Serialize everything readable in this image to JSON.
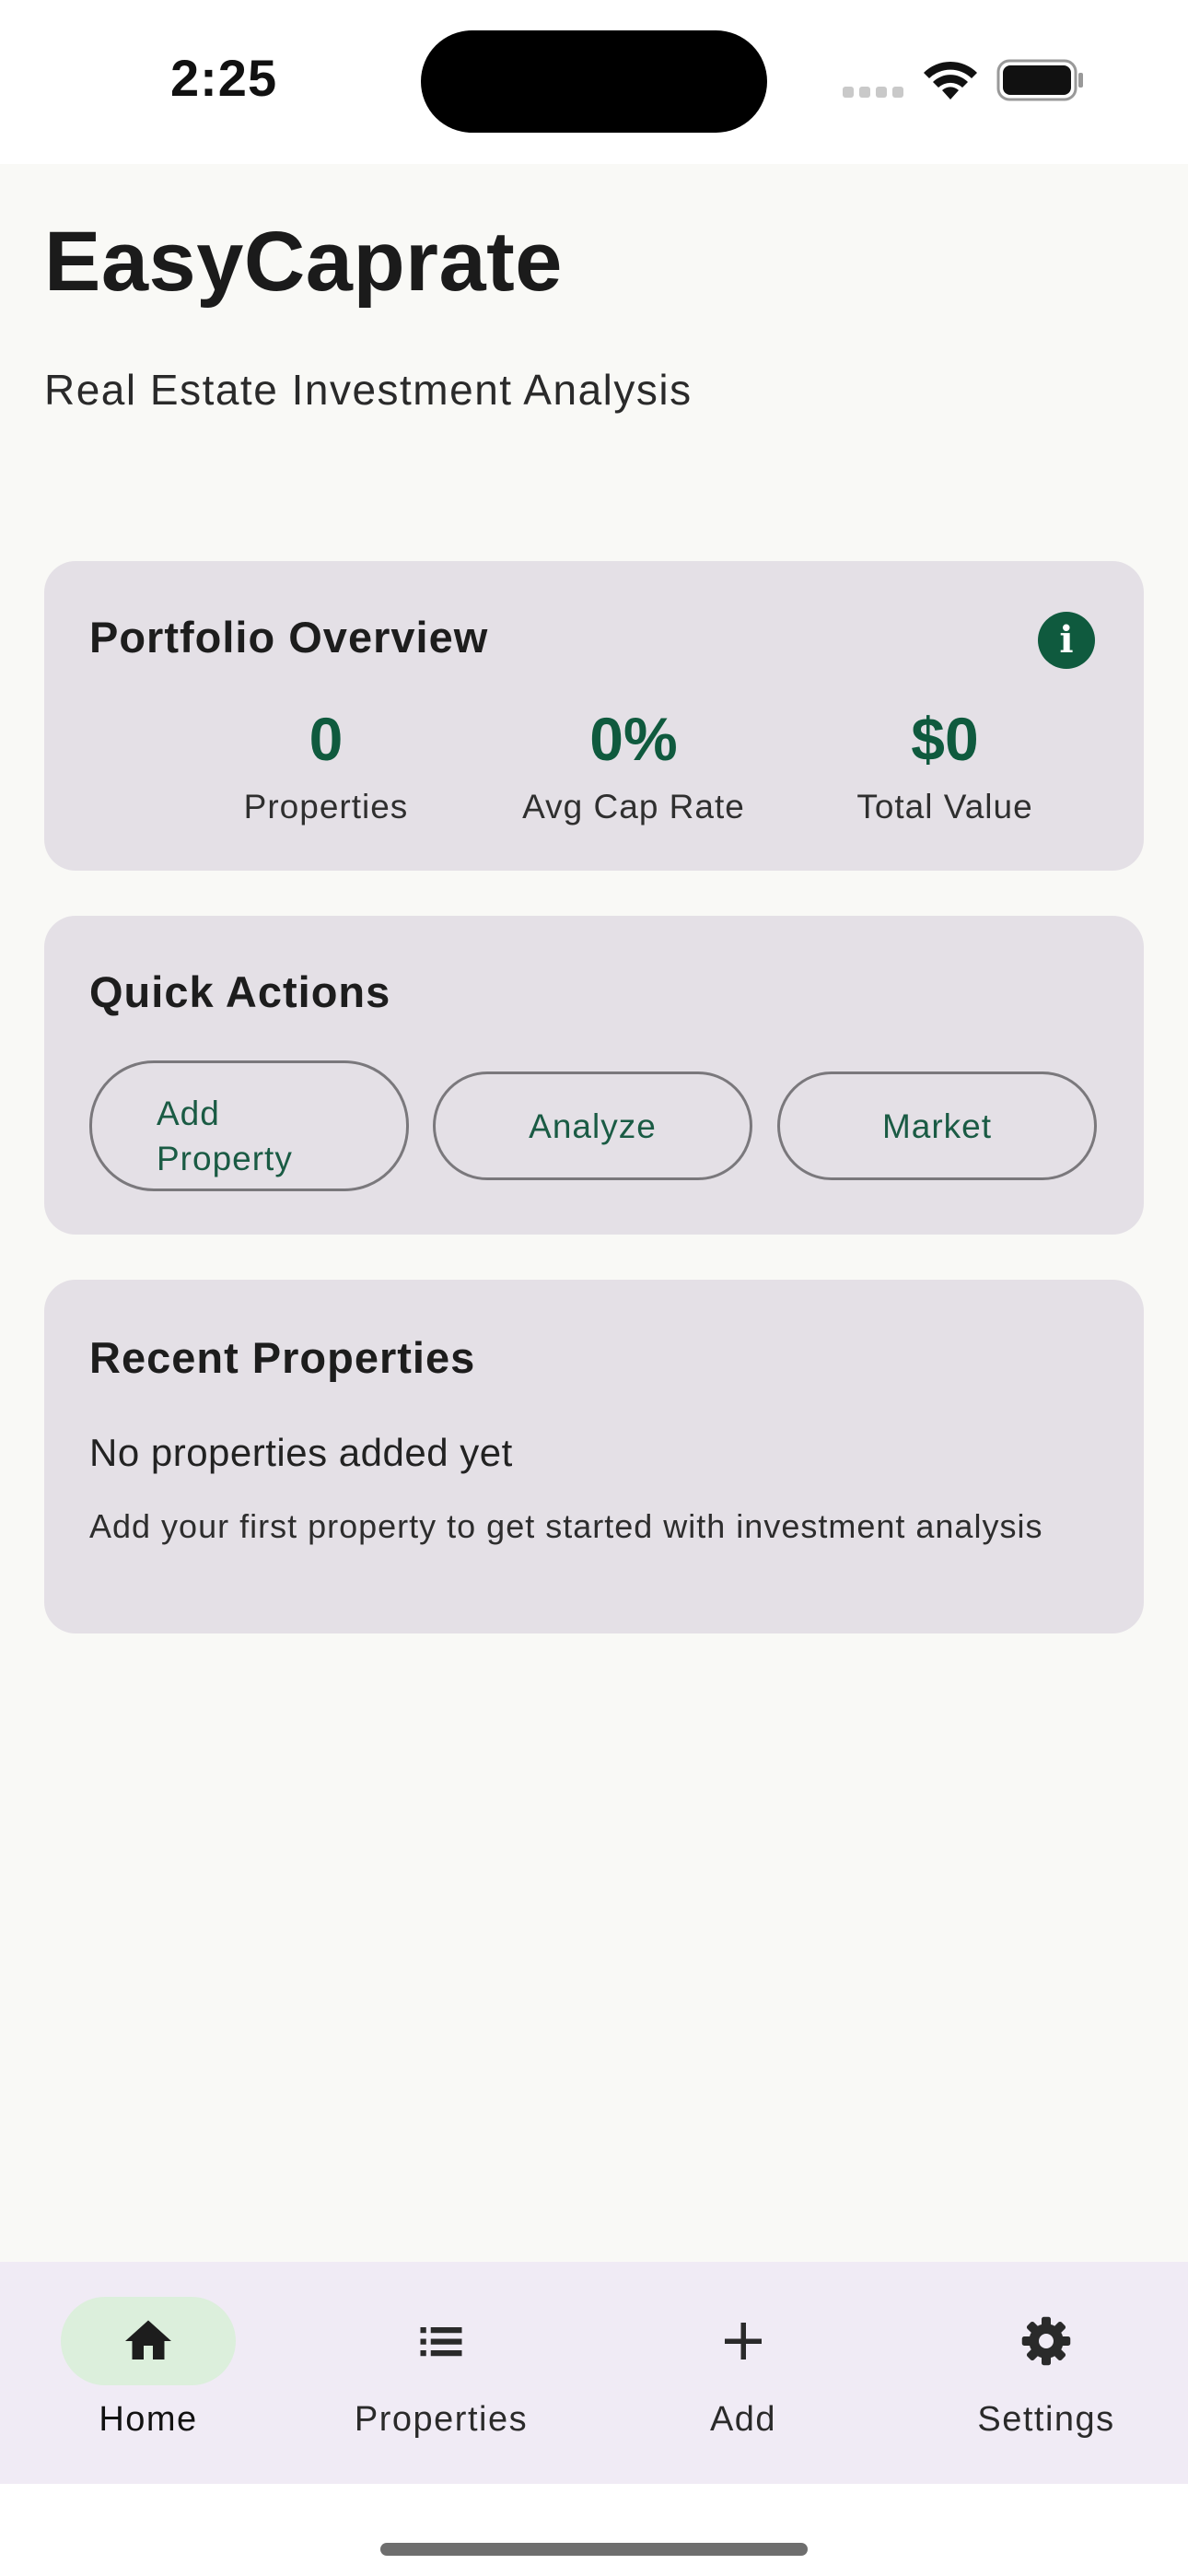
{
  "status_bar": {
    "time": "2:25"
  },
  "header": {
    "title": "EasyCaprate",
    "subtitle": "Real Estate Investment Analysis"
  },
  "portfolio": {
    "title": "Portfolio Overview",
    "info_icon": "info-icon",
    "stats": [
      {
        "value": "0",
        "label": "Properties"
      },
      {
        "value": "0%",
        "label": "Avg Cap Rate"
      },
      {
        "value": "$0",
        "label": "Total Value"
      }
    ]
  },
  "quick_actions": {
    "title": "Quick Actions",
    "add_property_line1": "Add",
    "add_property_line2": "Property",
    "analyze": "Analyze",
    "market": "Market"
  },
  "recent": {
    "title": "Recent Properties",
    "empty_title": "No properties added yet",
    "empty_desc": "Add your first property to get started with investment analysis"
  },
  "bottom_nav": {
    "items": [
      {
        "label": "Home",
        "icon": "home-icon",
        "active": true
      },
      {
        "label": "Properties",
        "icon": "list-icon",
        "active": false
      },
      {
        "label": "Add",
        "icon": "plus-icon",
        "active": false
      },
      {
        "label": "Settings",
        "icon": "gear-icon",
        "active": false
      }
    ]
  },
  "colors": {
    "accent": "#0f5a3e",
    "card_bg": "#e4e0e6",
    "page_bg": "#f9f9f6",
    "nav_bg": "#f0ebf5",
    "nav_active_pill": "#dcefdc"
  }
}
